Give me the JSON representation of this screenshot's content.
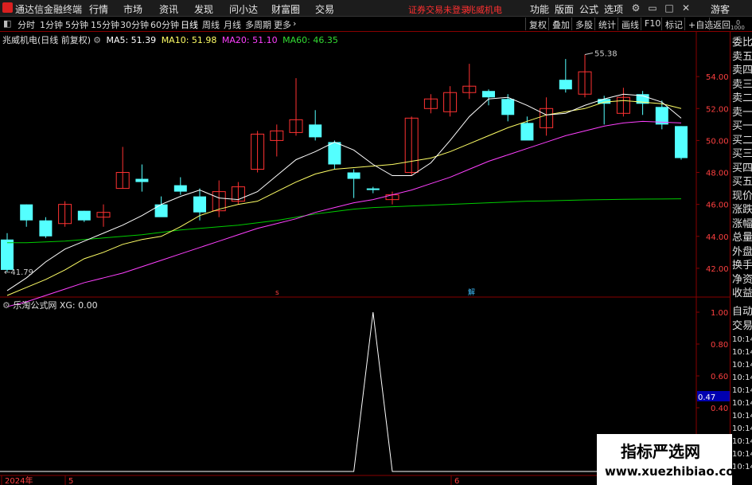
{
  "app": {
    "title": "通达信金融终端"
  },
  "menu": [
    "行情",
    "市场",
    "资讯",
    "发现",
    "问小达",
    "财富圈",
    "交易"
  ],
  "notice": "证券交易未登录",
  "stock_name": "兆威机电",
  "right_menu": [
    "功能",
    "版面",
    "公式",
    "选项"
  ],
  "guest": "游客",
  "periods": [
    "分时",
    "1分钟",
    "5分钟",
    "15分钟",
    "30分钟",
    "60分钟",
    "日线",
    "周线",
    "月线",
    "多周期",
    "更多"
  ],
  "active_period": "日线",
  "toolbar_right": [
    "复权",
    "叠加",
    "多股",
    "统计",
    "画线",
    "F10",
    "标记",
    "+自选",
    "返回"
  ],
  "info": {
    "title": "兆威机电(日线 前复权)",
    "ma5": "MA5: 51.39",
    "ma10": "MA10: 51.98",
    "ma20": "MA20: 51.10",
    "ma60": "MA60: 46.35"
  },
  "indicator": {
    "title": "乐淘公式网",
    "value": "XG: 0.00"
  },
  "colors": {
    "up": "#ff3232",
    "down": "#54ffff",
    "ma5": "#ffffff",
    "ma10": "#ffff66",
    "ma20": "#ff40ff",
    "ma60": "#00cc00",
    "axis": "#880000"
  },
  "chart_data": {
    "type": "candlestick",
    "title": "兆威机电(日线 前复权)",
    "yticks": [
      "54.00",
      "52.00",
      "50.00",
      "48.00",
      "46.00",
      "44.00",
      "42.00"
    ],
    "ylim": [
      40.2,
      56.8
    ],
    "high_label": "55.38",
    "low_label": "41.79",
    "x_labels": [
      "2024年",
      "5",
      "6"
    ],
    "markers": [
      "s",
      "解"
    ],
    "candles": [
      {
        "o": 43.8,
        "h": 44.2,
        "l": 41.79,
        "c": 41.9
      },
      {
        "o": 46.0,
        "h": 46.0,
        "l": 44.6,
        "c": 45.0
      },
      {
        "o": 45.0,
        "h": 45.2,
        "l": 43.9,
        "c": 44.0
      },
      {
        "o": 44.8,
        "h": 46.2,
        "l": 44.6,
        "c": 46.0
      },
      {
        "o": 45.6,
        "h": 45.6,
        "l": 44.9,
        "c": 45.0
      },
      {
        "o": 45.2,
        "h": 46.0,
        "l": 44.6,
        "c": 45.5
      },
      {
        "o": 47.0,
        "h": 49.6,
        "l": 47.0,
        "c": 48.0
      },
      {
        "o": 47.6,
        "h": 48.5,
        "l": 46.8,
        "c": 47.4
      },
      {
        "o": 46.0,
        "h": 46.5,
        "l": 45.4,
        "c": 45.2
      },
      {
        "o": 47.2,
        "h": 47.7,
        "l": 46.6,
        "c": 46.8
      },
      {
        "o": 46.5,
        "h": 47.0,
        "l": 45.0,
        "c": 45.5
      },
      {
        "o": 45.6,
        "h": 47.5,
        "l": 45.2,
        "c": 46.8
      },
      {
        "o": 46.2,
        "h": 47.4,
        "l": 46.0,
        "c": 47.1
      },
      {
        "o": 48.2,
        "h": 50.6,
        "l": 48.0,
        "c": 50.4
      },
      {
        "o": 50.0,
        "h": 51.0,
        "l": 49.0,
        "c": 50.6
      },
      {
        "o": 50.5,
        "h": 53.9,
        "l": 50.3,
        "c": 51.3
      },
      {
        "o": 51.0,
        "h": 51.9,
        "l": 50.0,
        "c": 50.2
      },
      {
        "o": 49.9,
        "h": 50.0,
        "l": 48.2,
        "c": 48.5
      },
      {
        "o": 48.0,
        "h": 48.2,
        "l": 46.4,
        "c": 47.6
      },
      {
        "o": 47.0,
        "h": 47.1,
        "l": 46.7,
        "c": 46.9
      },
      {
        "o": 46.3,
        "h": 46.8,
        "l": 46.0,
        "c": 46.6
      },
      {
        "o": 48.0,
        "h": 51.5,
        "l": 47.8,
        "c": 51.4
      },
      {
        "o": 52.0,
        "h": 52.9,
        "l": 51.7,
        "c": 52.6
      },
      {
        "o": 51.8,
        "h": 53.4,
        "l": 51.5,
        "c": 53.0
      },
      {
        "o": 53.0,
        "h": 54.8,
        "l": 52.6,
        "c": 53.4
      },
      {
        "o": 53.1,
        "h": 53.2,
        "l": 52.2,
        "c": 52.7
      },
      {
        "o": 52.6,
        "h": 52.9,
        "l": 51.2,
        "c": 51.6
      },
      {
        "o": 51.1,
        "h": 51.5,
        "l": 50.6,
        "c": 50.0
      },
      {
        "o": 50.8,
        "h": 52.7,
        "l": 50.3,
        "c": 52.0
      },
      {
        "o": 53.8,
        "h": 55.1,
        "l": 53.0,
        "c": 53.2
      },
      {
        "o": 52.9,
        "h": 55.38,
        "l": 52.7,
        "c": 54.3
      },
      {
        "o": 52.6,
        "h": 52.8,
        "l": 51.0,
        "c": 52.3
      },
      {
        "o": 51.7,
        "h": 53.3,
        "l": 51.5,
        "c": 52.7
      },
      {
        "o": 52.9,
        "h": 53.1,
        "l": 51.6,
        "c": 52.3
      },
      {
        "o": 52.1,
        "h": 52.5,
        "l": 50.7,
        "c": 51.0
      },
      {
        "o": 50.9,
        "h": 50.9,
        "l": 48.8,
        "c": 48.9
      }
    ],
    "ma5": [
      40.6,
      41.4,
      42.4,
      43.2,
      43.7,
      44.2,
      44.7,
      45.3,
      46.0,
      46.5,
      46.9,
      46.4,
      46.3,
      46.8,
      47.8,
      48.8,
      49.3,
      49.9,
      49.4,
      48.5,
      47.8,
      47.8,
      48.6,
      50.0,
      51.5,
      52.6,
      52.7,
      52.2,
      51.6,
      51.7,
      52.2,
      52.6,
      52.9,
      52.8,
      52.4,
      51.4
    ],
    "ma10": [
      40.3,
      40.8,
      41.3,
      41.9,
      42.6,
      43.0,
      43.5,
      43.8,
      44.0,
      44.6,
      45.3,
      45.7,
      46.0,
      46.2,
      46.8,
      47.4,
      47.9,
      48.2,
      48.3,
      48.4,
      48.5,
      48.7,
      48.9,
      49.3,
      49.8,
      50.3,
      50.8,
      51.2,
      51.6,
      51.8,
      52.0,
      52.4,
      52.5,
      52.4,
      52.3,
      52.0
    ],
    "ma20": [
      39.6,
      39.9,
      40.3,
      40.7,
      41.1,
      41.4,
      41.7,
      42.1,
      42.5,
      42.9,
      43.3,
      43.7,
      44.1,
      44.5,
      44.8,
      45.1,
      45.5,
      45.8,
      46.1,
      46.3,
      46.6,
      46.9,
      47.3,
      47.7,
      48.2,
      48.7,
      49.1,
      49.5,
      49.9,
      50.3,
      50.6,
      50.9,
      51.1,
      51.2,
      51.15,
      51.1
    ],
    "ma60": [
      43.6,
      43.6,
      43.65,
      43.7,
      43.8,
      43.9,
      44.0,
      44.1,
      44.25,
      44.4,
      44.5,
      44.6,
      44.7,
      44.85,
      45.0,
      45.2,
      45.4,
      45.55,
      45.7,
      45.8,
      45.85,
      45.9,
      45.95,
      46.0,
      46.05,
      46.1,
      46.15,
      46.2,
      46.22,
      46.25,
      46.28,
      46.3,
      46.32,
      46.33,
      46.34,
      46.35
    ],
    "indicator": {
      "name": "XG",
      "yticks": [
        "1.00",
        "0.80",
        "0.60",
        "0.40",
        "0.20"
      ],
      "current_label": "0.47",
      "ylim": [
        0,
        1
      ],
      "values": [
        0,
        0,
        0,
        0,
        0,
        0,
        0,
        0,
        0,
        0,
        0,
        0,
        0,
        0,
        0,
        0,
        0,
        0,
        0,
        1,
        0,
        0,
        0,
        0,
        0,
        0,
        0,
        0,
        0,
        0,
        0,
        0,
        0,
        0,
        0,
        0
      ]
    }
  },
  "right_panel": [
    "委比",
    "卖五",
    "卖四",
    "卖三",
    "卖二",
    "卖一",
    "买一",
    "买二",
    "买三",
    "买四",
    "买五",
    "现价",
    "涨跌",
    "涨幅",
    "总量",
    "外盘",
    "换手",
    "净资",
    "收益",
    "自动",
    "交易"
  ],
  "right_panel_top": "0",
  "right_panel_top2": "1000",
  "times": [
    "10:14",
    "10:14",
    "10:14",
    "10:14",
    "10:14",
    "10:14",
    "10:14",
    "10:14",
    "10:14",
    "10:14",
    "10:14"
  ],
  "watermark": {
    "title": "指标严选网",
    "url": "www.xuezhibiao.com"
  }
}
